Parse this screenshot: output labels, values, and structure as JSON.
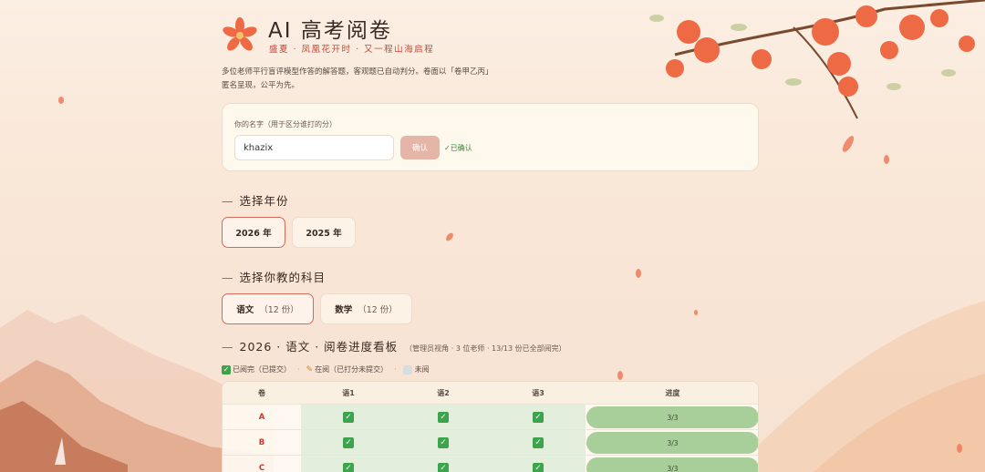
{
  "header": {
    "title": "AI 高考阅卷",
    "subtitle": "盛夏 · 凤凰花开时 · 又一程山海启程",
    "description": "多位老师平行盲评模型作答的解答题，客观题已自动判分。卷面以「卷甲乙丙」匿名呈现，公平为先。"
  },
  "name_card": {
    "label": "你的名字（用于区分谁打的分）",
    "input_value": "khazix",
    "confirm_label": "确认",
    "status": "✓已确认"
  },
  "year_section": {
    "heading": "选择年份",
    "options": [
      {
        "label": "2026 年",
        "selected": true
      },
      {
        "label": "2025 年",
        "selected": false
      }
    ]
  },
  "subject_section": {
    "heading": "选择你教的科目",
    "options": [
      {
        "label": "语文",
        "count": "（12 份）",
        "selected": true
      },
      {
        "label": "数学",
        "count": "（12 份）",
        "selected": false
      }
    ]
  },
  "board": {
    "heading": "2026 · 语文 · 阅卷进度看板",
    "note": "（管理员视角 · 3 位老师 · 13/13 份已全部阅完）",
    "legend": {
      "done": "已阅完（已提交）",
      "in_progress": "在阅（已打分未提交）",
      "unread": "未阅"
    },
    "columns": [
      "卷",
      "语1",
      "语2",
      "语3",
      "进度"
    ],
    "rows": [
      {
        "id": "A",
        "marks": [
          "done",
          "done",
          "done"
        ],
        "progress": "3/3",
        "progress_fraction": 1.0
      },
      {
        "id": "B",
        "marks": [
          "done",
          "done",
          "done"
        ],
        "progress": "3/3",
        "progress_fraction": 1.0
      },
      {
        "id": "C",
        "marks": [
          "done",
          "done",
          "done"
        ],
        "progress": "3/3",
        "progress_fraction": 1.0
      }
    ]
  },
  "colors": {
    "accent": "#c8473a",
    "done": "#3aa54a",
    "progress": "#a8cf9a"
  },
  "icons": {
    "logo": "phoenix-flower-icon",
    "done": "check-box-icon",
    "in_progress": "pencil-icon",
    "unread": "gray-box-icon"
  }
}
